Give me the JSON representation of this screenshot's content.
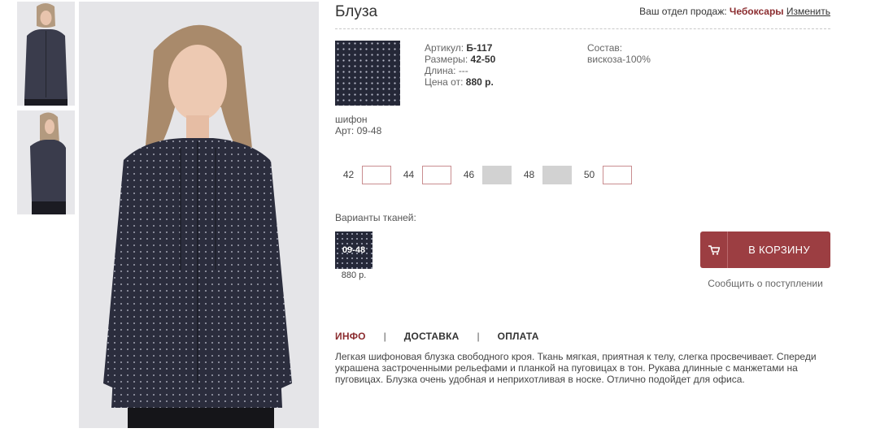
{
  "product": {
    "title": "Блуза",
    "fabric_name": "шифон",
    "fabric_art": "Арт: 09-48"
  },
  "sales": {
    "label": "Ваш отдел продаж:",
    "city": "Чебоксары",
    "change_link": "Изменить"
  },
  "specs": {
    "article_label": "Артикул:",
    "article_value": "Б-117",
    "sizes_label": "Размеры:",
    "sizes_value": "42-50",
    "length_label": "Длина:",
    "length_value": "---",
    "price_label": "Цена от:",
    "price_value": "880 р.",
    "composition_label": "Состав:",
    "composition_value": "вискоза-100%"
  },
  "size_grid": [
    {
      "label": "42",
      "available": true
    },
    {
      "label": "44",
      "available": true
    },
    {
      "label": "46",
      "available": false
    },
    {
      "label": "48",
      "available": false
    },
    {
      "label": "50",
      "available": true
    }
  ],
  "variants": {
    "label": "Варианты тканей:",
    "items": [
      {
        "code": "09-48",
        "price": "880 р."
      }
    ]
  },
  "cart": {
    "button_label": "В КОРЗИНУ",
    "notify_label": "Сообщить о поступлении",
    "accent_color": "#9c3e42"
  },
  "tabs": [
    {
      "label": "ИНФО",
      "active": true
    },
    {
      "label": "ДОСТАВКА",
      "active": false
    },
    {
      "label": "ОПЛАТА",
      "active": false
    }
  ],
  "tab_separator": "|",
  "description": "Легкая шифоновая блузка свободного кроя. Ткань мягкая, приятная к телу, слегка просвечивает. Спереди украшена застроченными рельефами и планкой на пуговицах в тон. Рукава длинные с манжетами на пуговицах. Блузка очень удобная и неприхотливая в носке. Отлично подойдет для офиса."
}
